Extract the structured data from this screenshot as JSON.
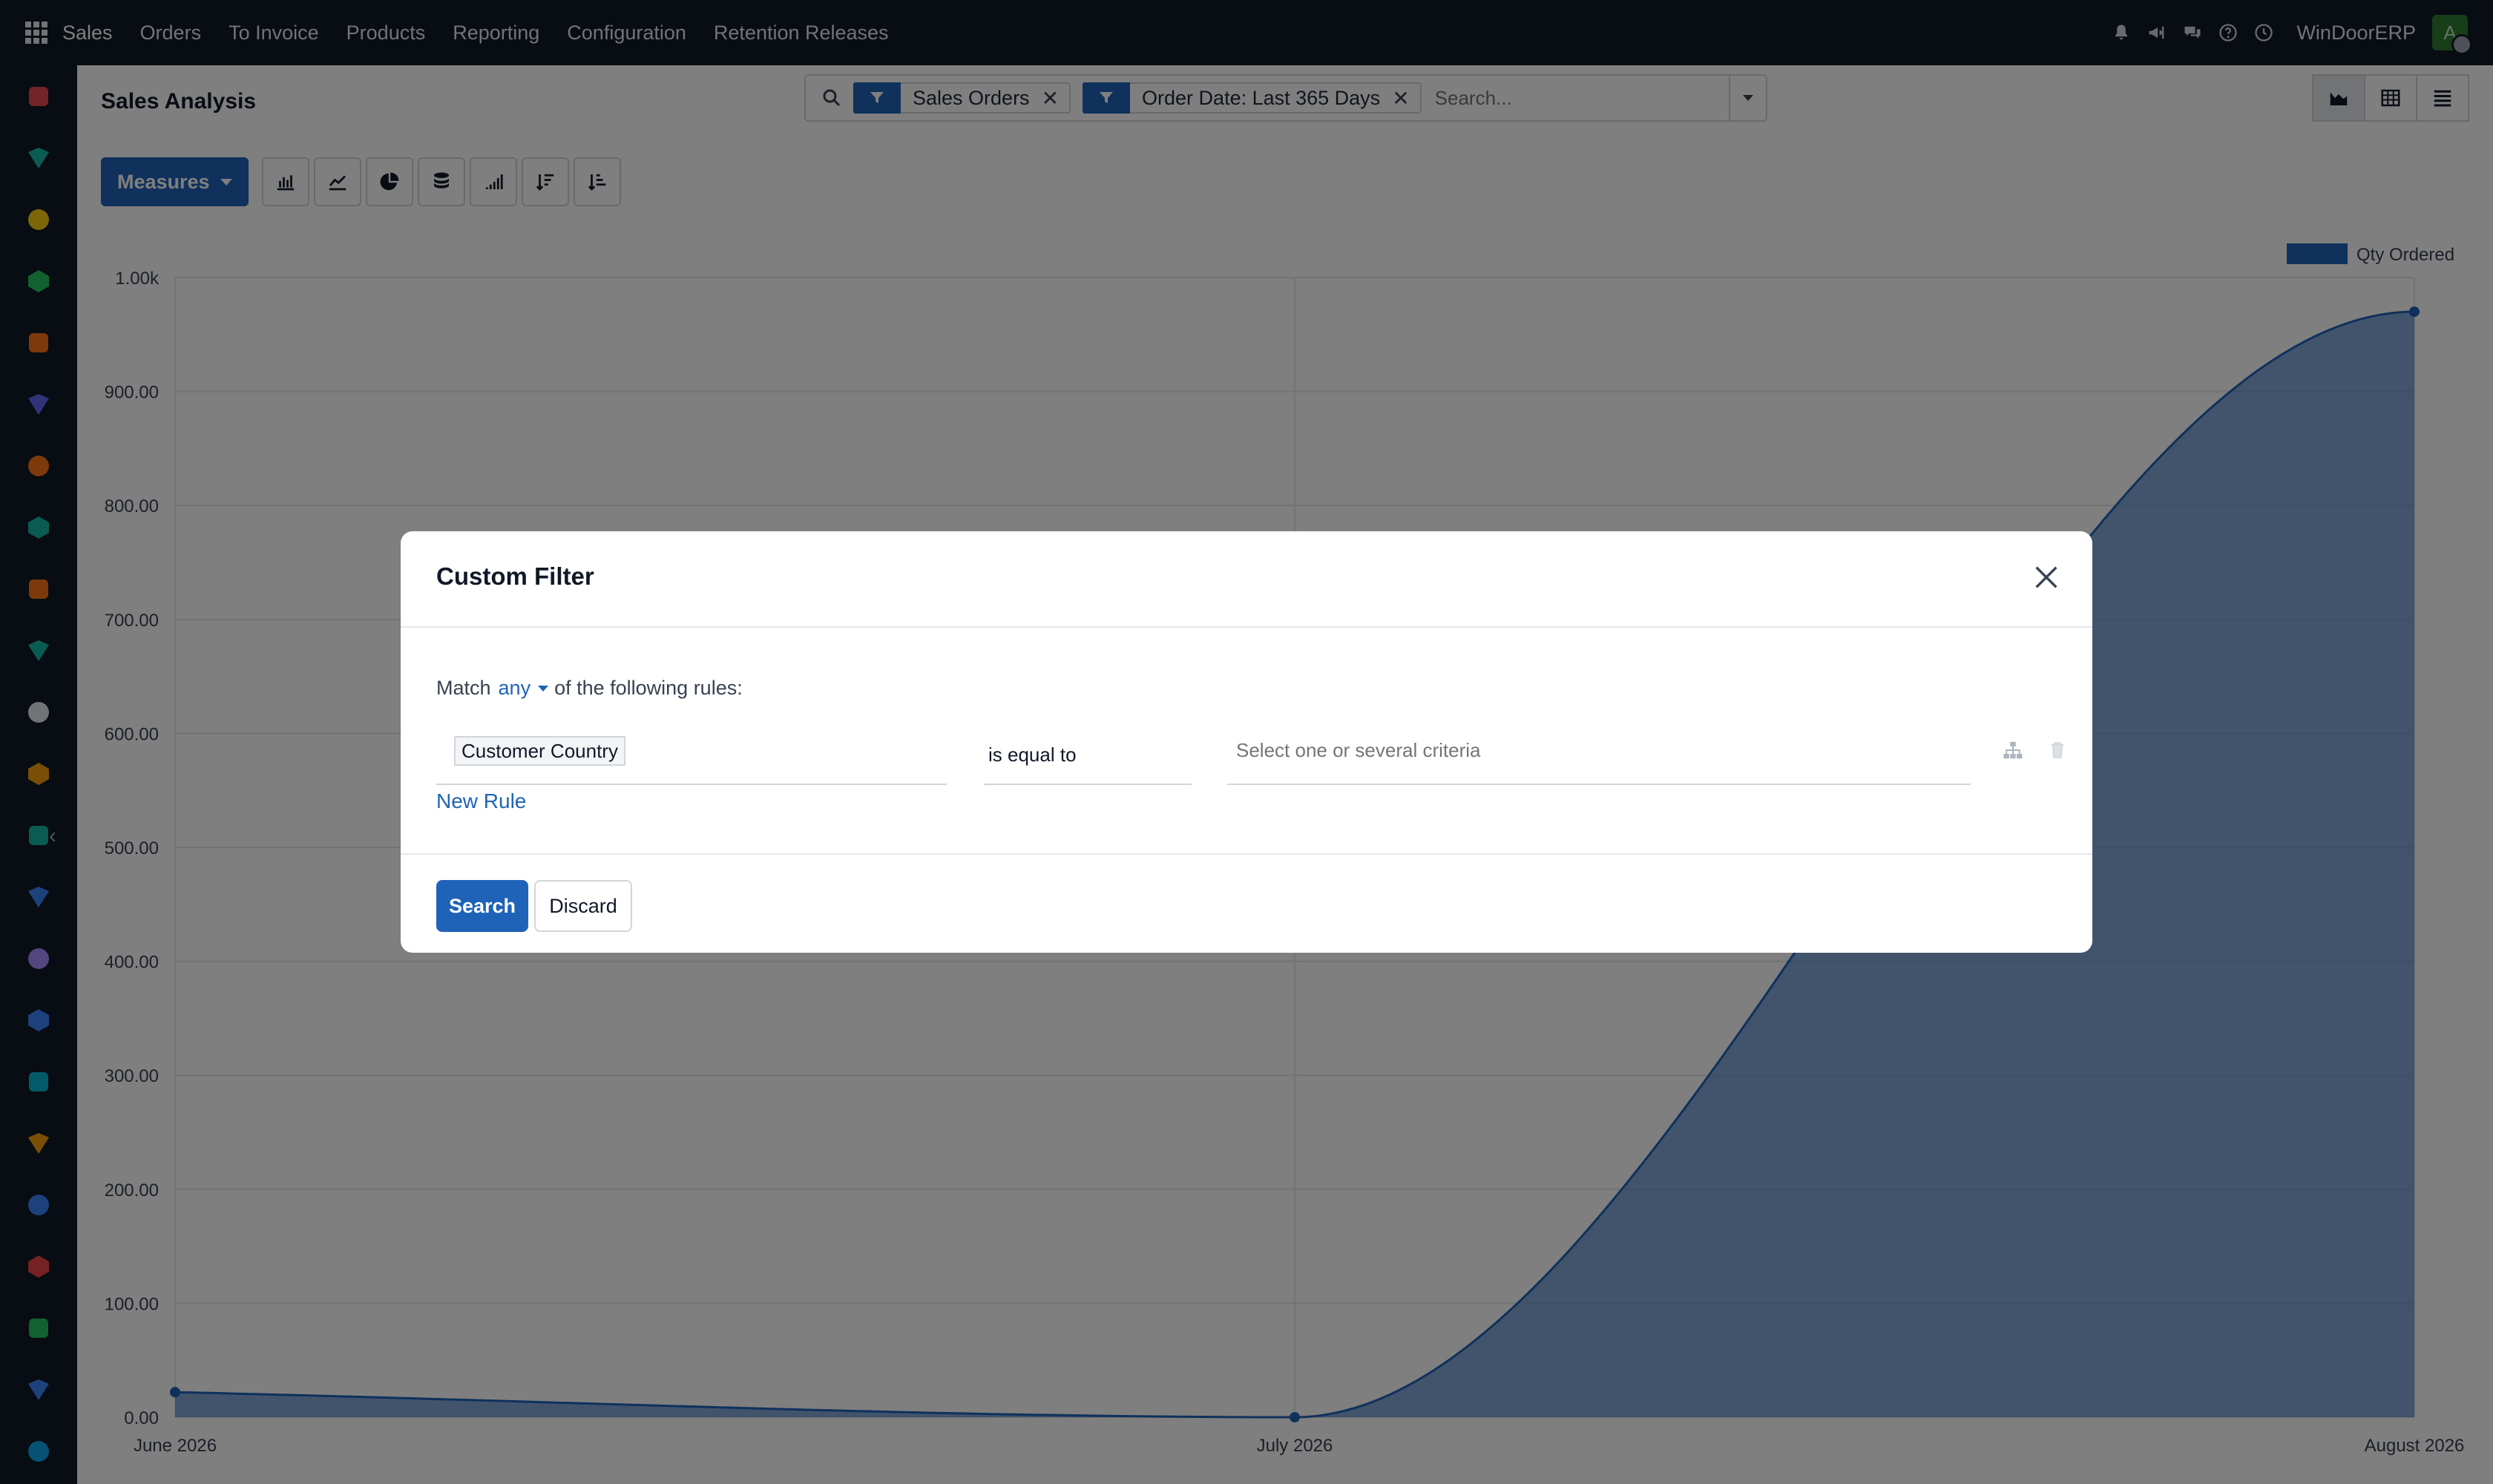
{
  "navbar": {
    "brand": "Sales",
    "menu": [
      {
        "label": "Orders"
      },
      {
        "label": "To Invoice"
      },
      {
        "label": "Products"
      },
      {
        "label": "Reporting"
      },
      {
        "label": "Configuration"
      },
      {
        "label": "Retention Releases"
      }
    ],
    "company": "WinDoorERP",
    "avatar_initial": "A",
    "icons": [
      "bell-icon",
      "megaphone-icon",
      "chat-icon",
      "help-icon",
      "clock-icon"
    ]
  },
  "sidebar": {
    "apps": [
      {
        "icon": "cube-app-icon",
        "color": "#e5484d"
      },
      {
        "icon": "sales-app-icon",
        "color": "#14b8a6"
      },
      {
        "icon": "send-app-icon",
        "color": "#facc15"
      },
      {
        "icon": "pie-app-icon",
        "color": "#22c55e"
      },
      {
        "icon": "hexagon-app-icon",
        "color": "#f97316"
      },
      {
        "icon": "mail-app-icon",
        "color": "#6366f1"
      },
      {
        "icon": "chat-app-icon",
        "color": "#f97316"
      },
      {
        "icon": "sales-app-icon-2",
        "color": "#14b8a6"
      },
      {
        "icon": "reporting-app-icon",
        "color": "#f97316"
      },
      {
        "icon": "contacts-app-icon",
        "color": "#14b8a6"
      },
      {
        "icon": "box-app-icon",
        "color": "#e5e7eb"
      },
      {
        "icon": "studio-app-icon",
        "color": "#f59e0b"
      },
      {
        "icon": "check-app-icon",
        "color": "#14b8a6"
      },
      {
        "icon": "knowledge-app-icon",
        "color": "#3b82f6"
      },
      {
        "icon": "inventory-app-icon",
        "color": "#a78bfa"
      },
      {
        "icon": "document-app-icon",
        "color": "#3b82f6"
      },
      {
        "icon": "team-app-icon",
        "color": "#06b6d4"
      },
      {
        "icon": "calendar-app-icon",
        "color": "#f59e0b"
      },
      {
        "icon": "sign-app-icon",
        "color": "#3b82f6"
      },
      {
        "icon": "dashboard-app-icon",
        "color": "#ef4444"
      },
      {
        "icon": "whatsapp-app-icon",
        "color": "#22c55e"
      },
      {
        "icon": "timer-app-icon",
        "color": "#3b82f6"
      },
      {
        "icon": "planning-app-icon",
        "color": "#0ea5e9"
      }
    ]
  },
  "control_panel": {
    "title": "Sales Analysis",
    "facets": [
      {
        "label": "Sales Orders"
      },
      {
        "label": "Order Date: Last 365 Days"
      }
    ],
    "search_placeholder": "Search...",
    "measures_label": "Measures"
  },
  "chart_data": {
    "type": "area",
    "x": [
      "June 2026",
      "July 2026",
      "August 2026"
    ],
    "series": [
      {
        "name": "Qty Ordered",
        "values": [
          22,
          0,
          970
        ]
      }
    ],
    "ylim": [
      0,
      1000
    ],
    "yticks": [
      "0.00",
      "100.00",
      "200.00",
      "300.00",
      "400.00",
      "500.00",
      "600.00",
      "700.00",
      "800.00",
      "900.00",
      "1.00k"
    ],
    "grid": true,
    "legend": "top-right",
    "color": "#1f63b8"
  },
  "modal": {
    "title": "Custom Filter",
    "match_prefix": "Match",
    "match_value": "any",
    "match_suffix": "of the following rules:",
    "rule": {
      "field": "Customer Country",
      "operator": "is equal to",
      "value_placeholder": "Select one or several criteria"
    },
    "new_rule_label": "New Rule",
    "search_label": "Search",
    "discard_label": "Discard"
  }
}
